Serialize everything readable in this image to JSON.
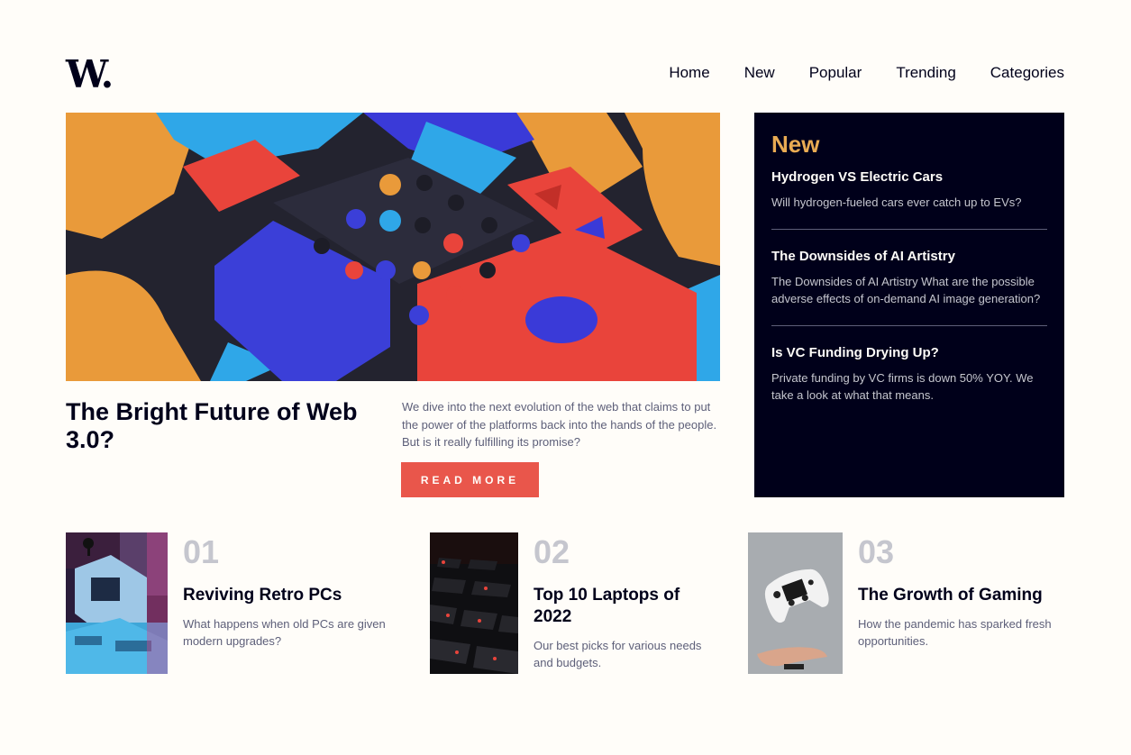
{
  "brand": {
    "logo": "W."
  },
  "nav": {
    "items": [
      "Home",
      "New",
      "Popular",
      "Trending",
      "Categories"
    ]
  },
  "hero": {
    "title": "The Bright Future of Web 3.0?",
    "description": "We dive into the next evolution of the web that claims to put the power of the platforms back into the hands of the people. But is it really fulfilling its promise?",
    "button_label": "READ MORE"
  },
  "new_panel": {
    "heading": "New",
    "items": [
      {
        "title": "Hydrogen VS Electric Cars",
        "description": "Will hydrogen-fueled cars ever catch up to EVs?"
      },
      {
        "title": "The Downsides of AI Artistry",
        "description": "The Downsides of AI Artistry What are the possible adverse effects of on-demand AI image generation?"
      },
      {
        "title": "Is VC Funding Drying Up?",
        "description": "Private funding by VC firms is down 50% YOY. We take a look at what that means."
      }
    ]
  },
  "cards": [
    {
      "number": "01",
      "title": "Reviving Retro PCs",
      "description": "What happens when old PCs are given modern upgrades?"
    },
    {
      "number": "02",
      "title": "Top 10 Laptops of 2022",
      "description": "Our best picks for various needs and budgets."
    },
    {
      "number": "03",
      "title": "The Growth of Gaming",
      "description": "How the pandemic has sparked fresh opportunities."
    }
  ],
  "colors": {
    "background": "#fffdf9",
    "dark_navy": "#00001a",
    "accent_red": "#e9564b",
    "accent_orange": "#e9ab53",
    "muted_text": "#5d5f79",
    "number_grey": "#c5c6ce"
  }
}
